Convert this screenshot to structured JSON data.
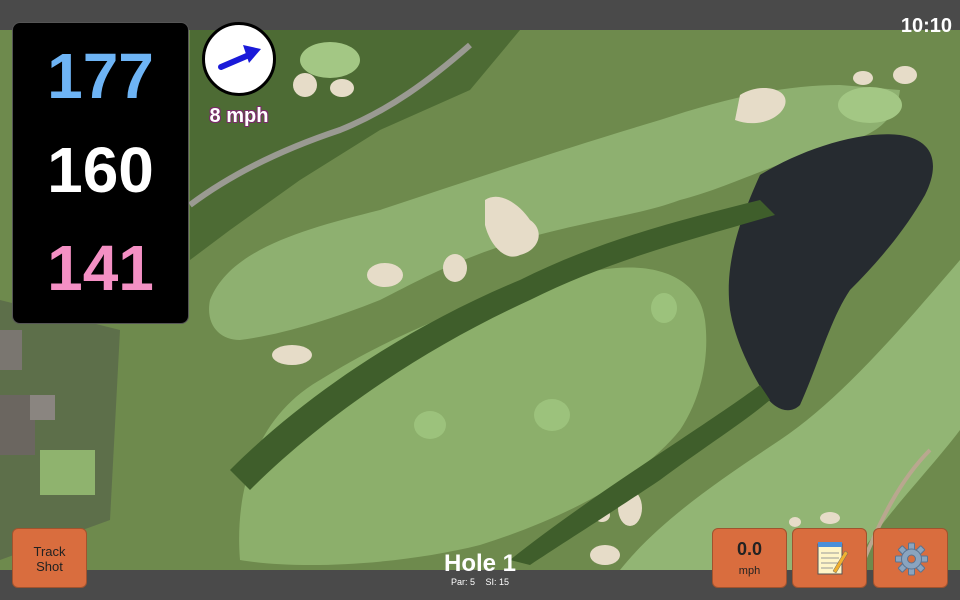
{
  "status": {
    "time": "10:10"
  },
  "distances": {
    "back": "177",
    "middle": "160",
    "front": "141",
    "colors": {
      "back": "#6eb4f5",
      "middle": "#ffffff",
      "front": "#f490c4"
    }
  },
  "wind": {
    "speed_label": "8 mph",
    "arrow_icon": "arrow-right-icon",
    "arrow_color": "#1a1ad9"
  },
  "buttons": {
    "track_shot_line1": "Track",
    "track_shot_line2": "Shot",
    "speed_value": "0.0",
    "speed_unit": "mph",
    "notes_icon": "notepad-icon",
    "settings_icon": "gear-icon",
    "color": "#d96d3e"
  },
  "hole": {
    "title": "Hole 1",
    "par": "Par: 5",
    "si": "SI: 15"
  },
  "map": {
    "type": "satellite-aerial-golf-course"
  }
}
